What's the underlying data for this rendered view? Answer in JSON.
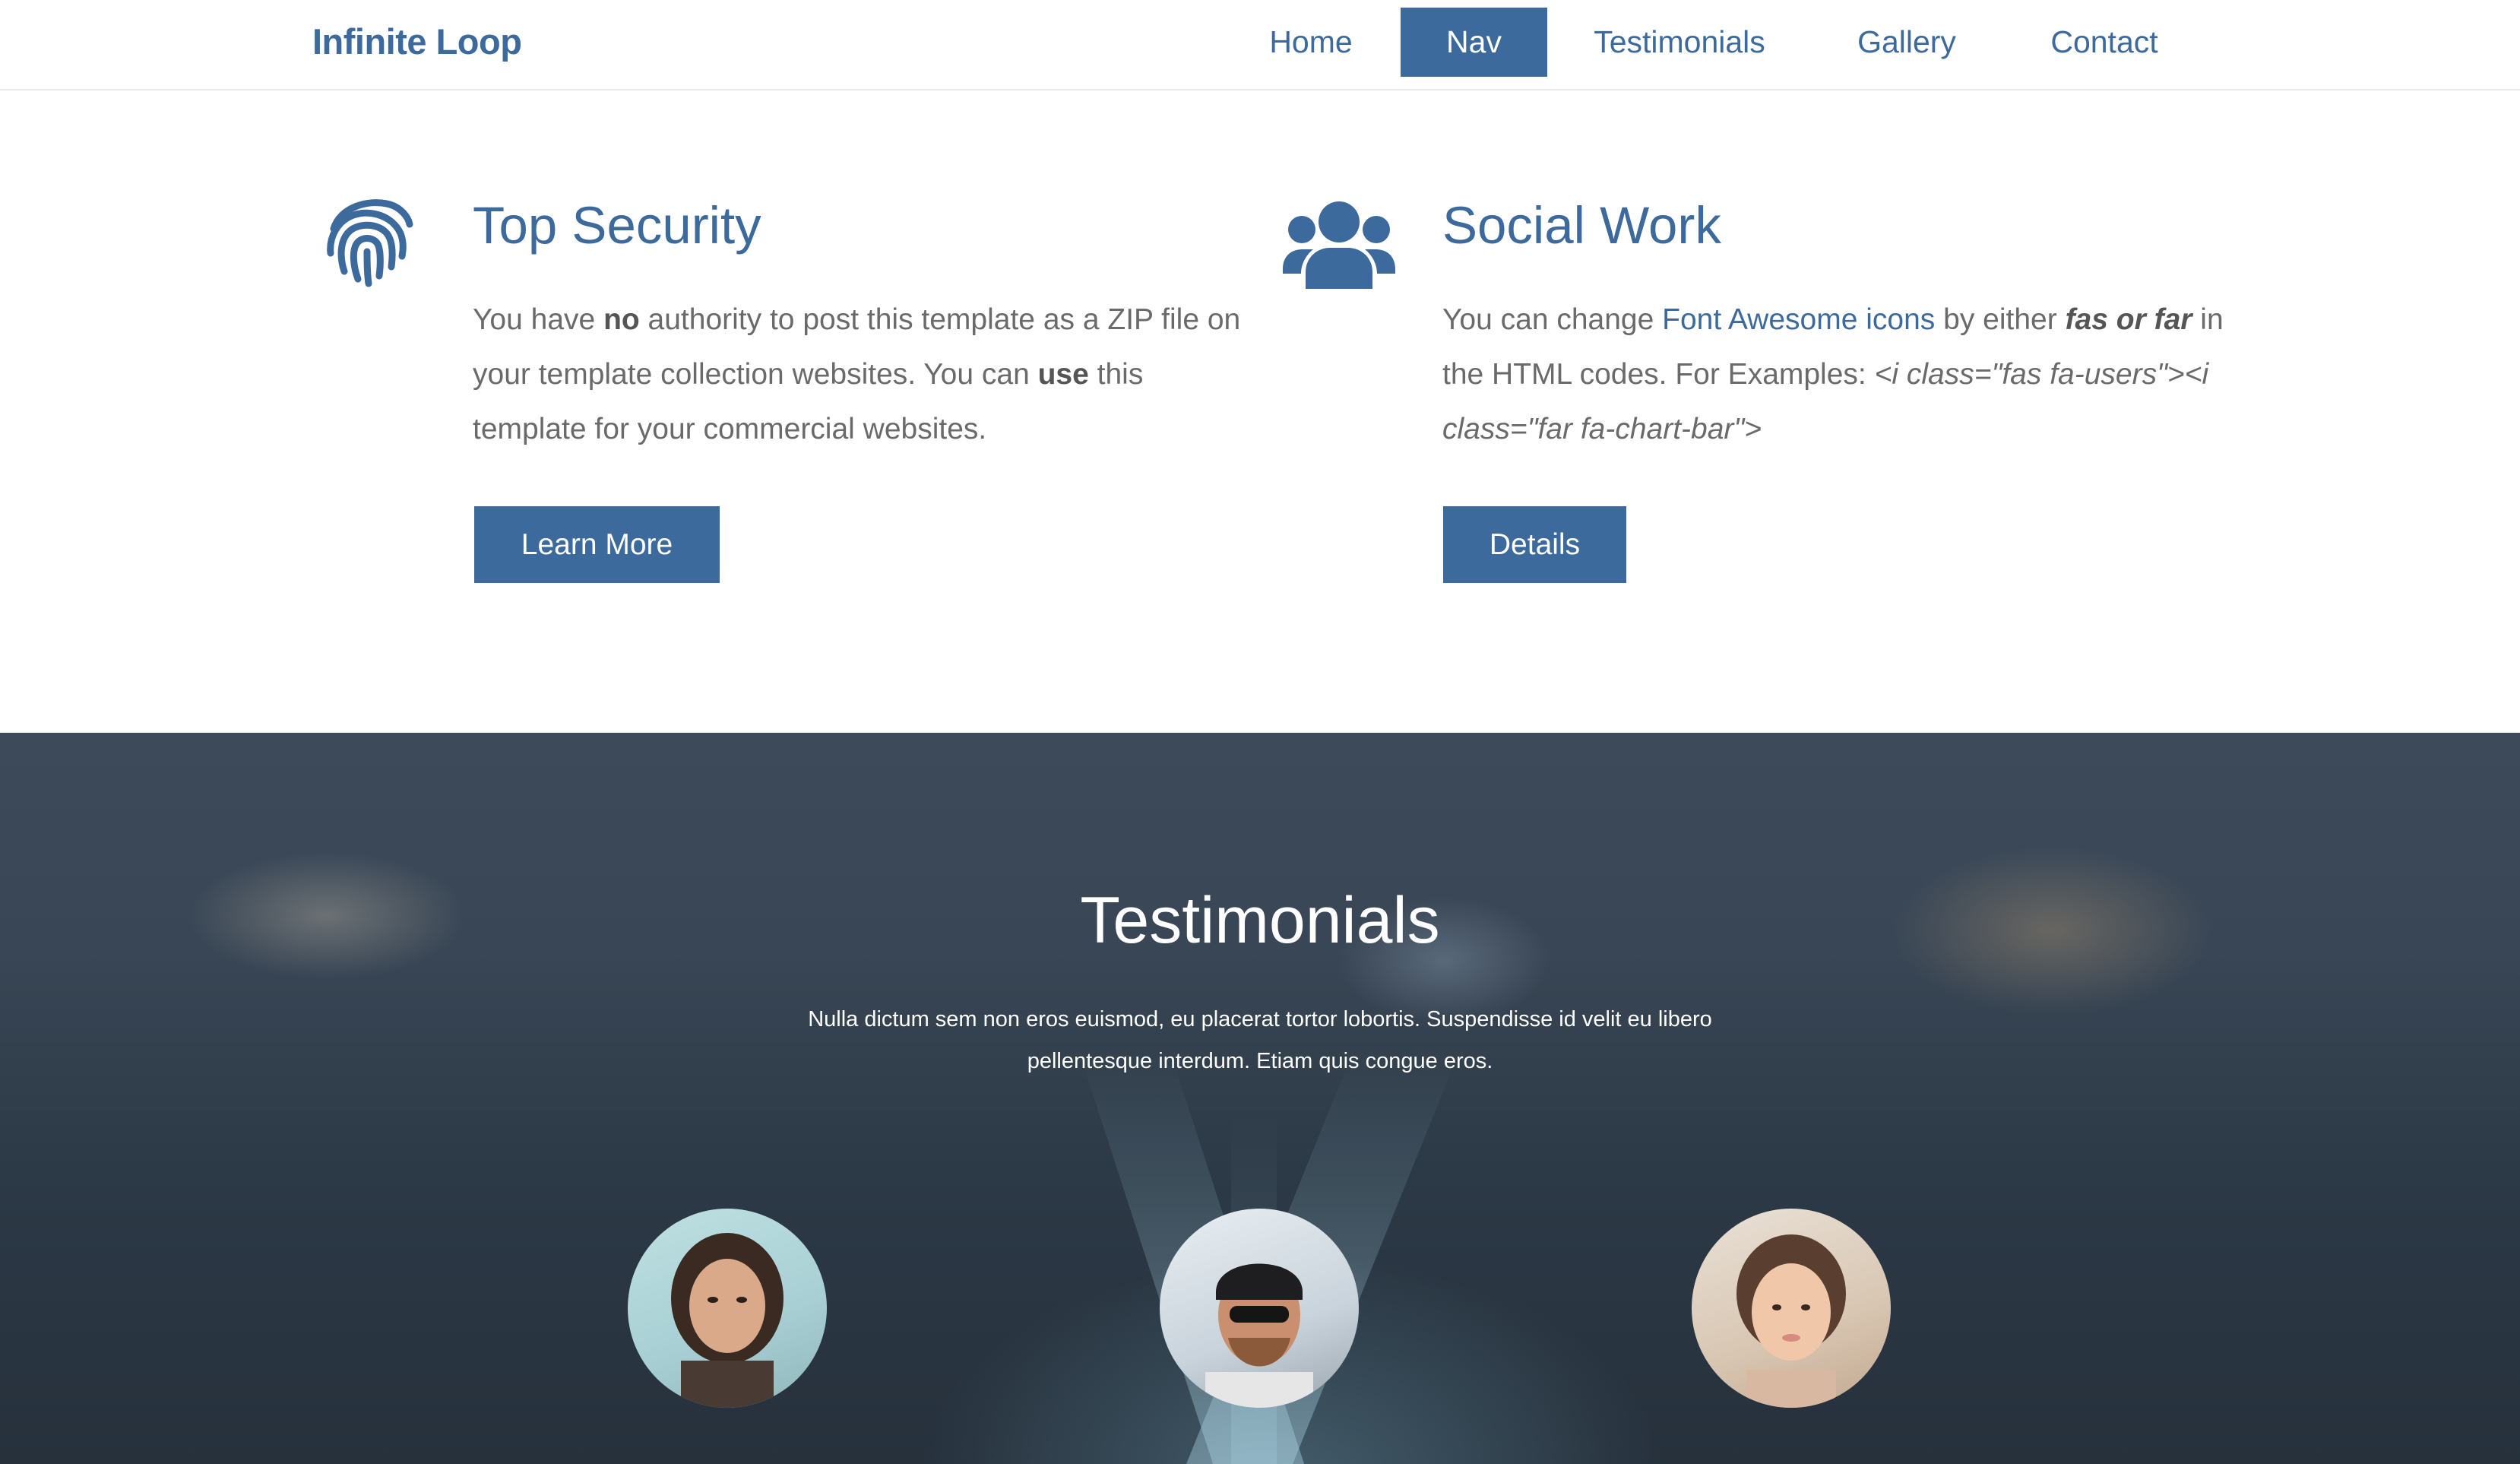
{
  "navbar": {
    "brand": "Infinite Loop",
    "items": [
      {
        "label": "Home",
        "active": false
      },
      {
        "label": "Nav",
        "active": true
      },
      {
        "label": "Testimonials",
        "active": false
      },
      {
        "label": "Gallery",
        "active": false
      },
      {
        "label": "Contact",
        "active": false
      }
    ]
  },
  "features": [
    {
      "icon": "fingerprint-icon",
      "title": "Top Security",
      "text_parts": [
        "You have ",
        "no",
        " authority to post this template as a ZIP file on your template collection websites. You can ",
        "use",
        " this template for your commercial websites."
      ],
      "button": "Learn More"
    },
    {
      "icon": "users-icon",
      "title": "Social Work",
      "text_parts": [
        "You can change ",
        "Font Awesome icons",
        " by either ",
        "fas or far",
        " in the HTML codes. For Examples: ",
        "<i class=\"fas fa-users\"><i class=\"far fa-chart-bar\">"
      ],
      "button": "Details"
    }
  ],
  "testimonials": {
    "title": "Testimonials",
    "text": "Nulla dictum sem non eros euismod, eu placerat tortor lobortis. Suspendisse id velit eu libero pellentesque interdum. Etiam quis congue eros.",
    "avatars": [
      "testimonial-avatar-1",
      "testimonial-avatar-2",
      "testimonial-avatar-3"
    ]
  },
  "colors": {
    "accent": "#3d6a9c",
    "text": "#6a6a6a",
    "white": "#ffffff"
  }
}
